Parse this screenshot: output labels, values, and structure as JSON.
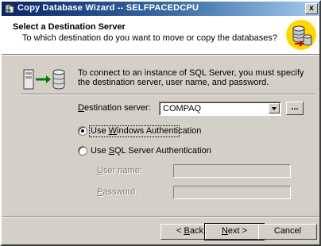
{
  "window": {
    "title": "Copy Database Wizard -- SELFPACEDCPU",
    "close_glyph": "x"
  },
  "header": {
    "title": "Select a Destination Server",
    "subtitle": "To which destination do you want to move or copy the databases?",
    "icon": "wizard-database-icon"
  },
  "info": {
    "text": "To connect to an instance of SQL Server, you must specify the destination server, user name, and password.",
    "icon": "server-transfer-icon"
  },
  "destination": {
    "label_pre": "",
    "label_access": "D",
    "label_post": "estination server:",
    "value": "COMPAQ",
    "browse_label": "..."
  },
  "auth": {
    "windows": {
      "pre": "Use ",
      "access": "W",
      "post": "indows Authentication",
      "selected": true
    },
    "sql": {
      "pre": "Use ",
      "access": "S",
      "post": "QL Server Authentication",
      "selected": false
    }
  },
  "credentials": {
    "user": {
      "access": "U",
      "post": "ser name:",
      "value": ""
    },
    "password": {
      "access": "P",
      "post": "assword:",
      "value": ""
    }
  },
  "footer": {
    "back": {
      "pre": "< ",
      "access": "B",
      "post": "ack"
    },
    "next": {
      "pre": "",
      "access": "N",
      "post": "ext >"
    },
    "cancel": "Cancel"
  },
  "colors": {
    "titlebar_start": "#0a246a",
    "titlebar_end": "#a6caf0",
    "face": "#d4d0c8",
    "wizard_icon_bg": "#ffd800"
  }
}
